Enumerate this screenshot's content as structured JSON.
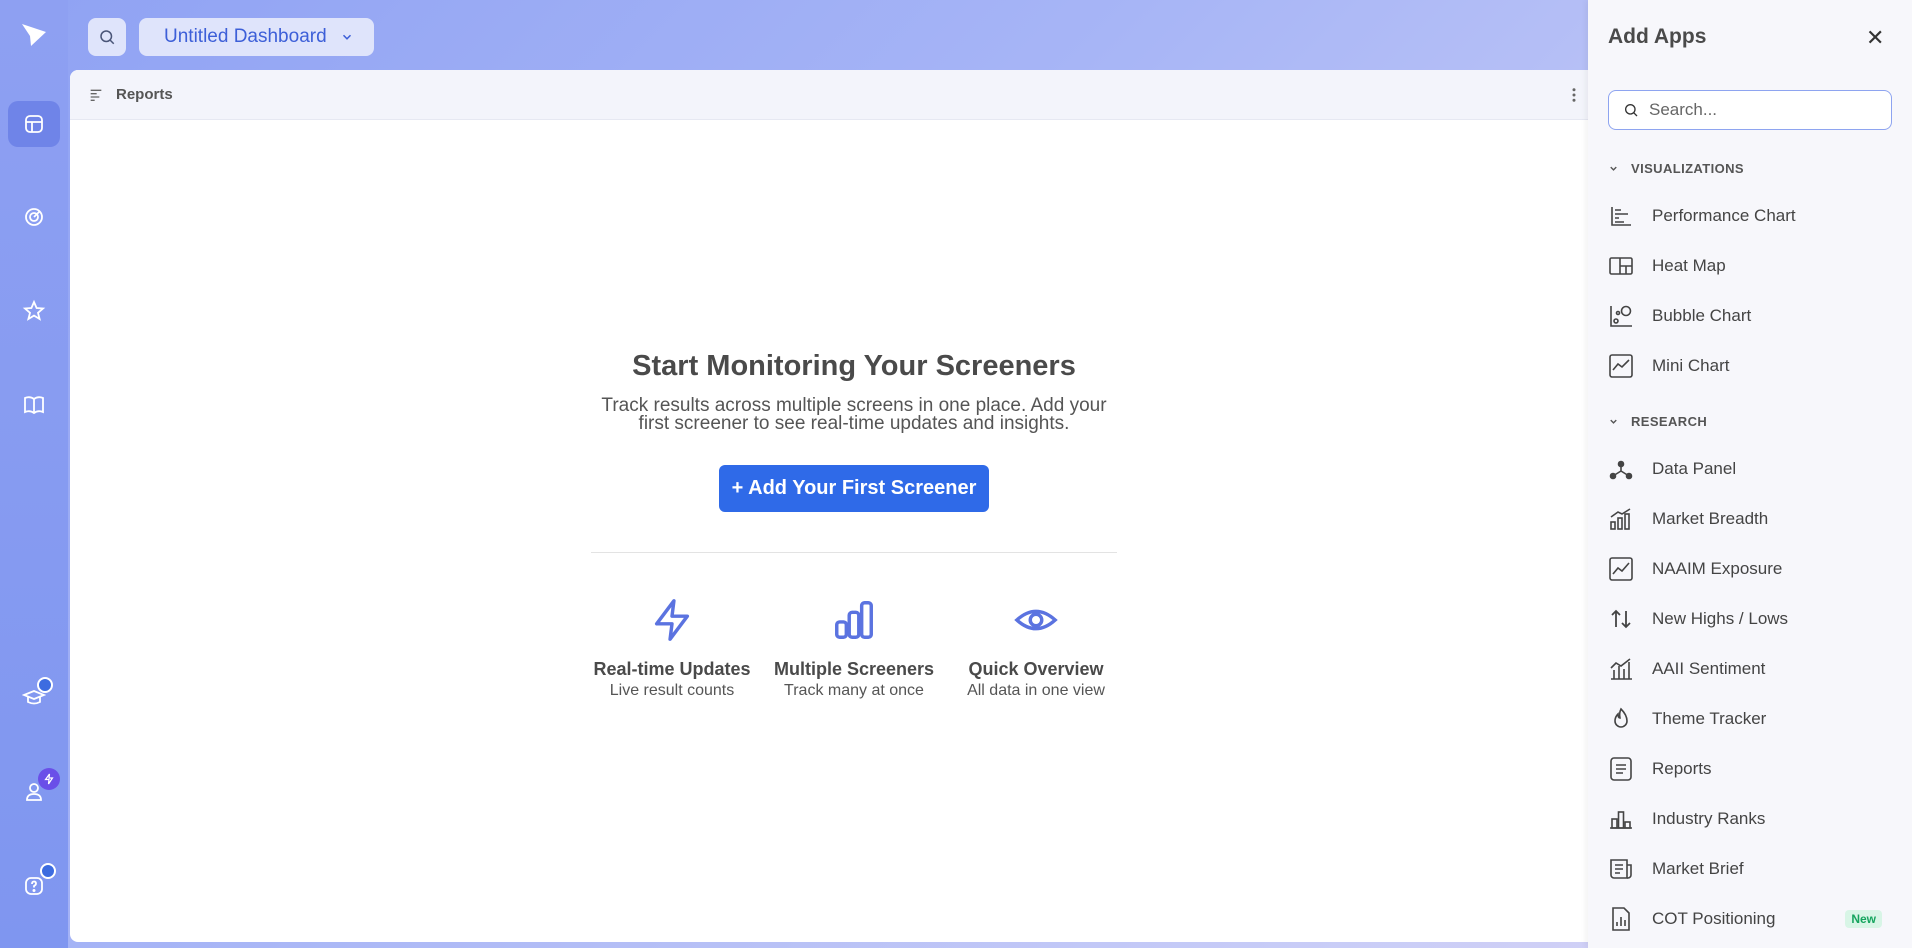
{
  "header": {
    "dashboard_name": "Untitled Dashboard"
  },
  "panel": {
    "title": "Reports"
  },
  "empty_state": {
    "heading": "Start Monitoring Your Screeners",
    "description": "Track results across multiple screens in one place. Add your first screener to see real-time updates and insights.",
    "cta_label": "+ Add Your First Screener",
    "features": [
      {
        "title": "Real-time Updates",
        "desc": "Live result counts"
      },
      {
        "title": "Multiple Screeners",
        "desc": "Track many at once"
      },
      {
        "title": "Quick Overview",
        "desc": "All data in one view"
      }
    ]
  },
  "drawer": {
    "title": "Add Apps",
    "close_label": "✕",
    "search_placeholder": "Search...",
    "sections": [
      {
        "label": "VISUALIZATIONS"
      },
      {
        "label": "RESEARCH"
      }
    ],
    "visualizations": [
      {
        "label": "Performance Chart",
        "icon": "performance-chart-icon"
      },
      {
        "label": "Heat Map",
        "icon": "heat-map-icon"
      },
      {
        "label": "Bubble Chart",
        "icon": "bubble-chart-icon"
      },
      {
        "label": "Mini Chart",
        "icon": "mini-chart-icon"
      }
    ],
    "research": [
      {
        "label": "Data Panel",
        "icon": "data-panel-icon"
      },
      {
        "label": "Market Breadth",
        "icon": "market-breadth-icon"
      },
      {
        "label": "NAAIM Exposure",
        "icon": "naaim-exposure-icon"
      },
      {
        "label": "New Highs / Lows",
        "icon": "new-highs-lows-icon"
      },
      {
        "label": "AAII Sentiment",
        "icon": "aaii-sentiment-icon"
      },
      {
        "label": "Theme Tracker",
        "icon": "theme-tracker-icon"
      },
      {
        "label": "Reports",
        "icon": "reports-icon"
      },
      {
        "label": "Industry Ranks",
        "icon": "industry-ranks-icon"
      },
      {
        "label": "Market Brief",
        "icon": "market-brief-icon"
      },
      {
        "label": "COT Positioning",
        "icon": "cot-positioning-icon",
        "badge": "New"
      }
    ]
  },
  "colors": {
    "accent": "#2f6ae8",
    "rail": "#8ea0f2",
    "badge_new": "#15a45e"
  }
}
